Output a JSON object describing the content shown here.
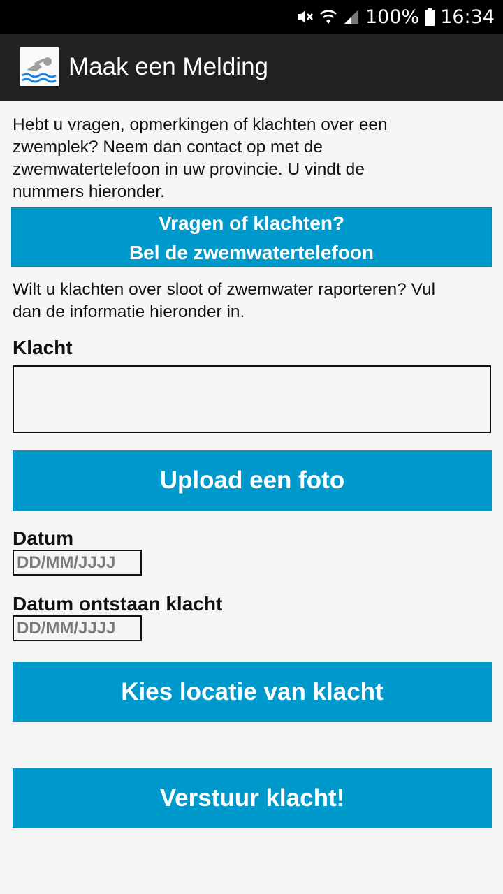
{
  "status_bar": {
    "battery": "100%",
    "time": "16:34"
  },
  "app_bar": {
    "title": "Maak een Melding",
    "icon": "swimmer-icon"
  },
  "intro_text": "Hebt u vragen, opmerkingen of klachten over een zwemplek? Neem dan contact op met de zwemwatertelefoon in uw provincie. U vindt de nummers hieronder.",
  "call_button": {
    "line1": "Vragen of klachten?",
    "line2": "Bel de zwemwatertelefoon"
  },
  "info_text": "Wilt u klachten over sloot of zwemwater raporteren? Vul dan de informatie hieronder in.",
  "form": {
    "klacht_label": "Klacht",
    "klacht_value": "",
    "upload_label": "Upload een foto",
    "datum_label": "Datum",
    "datum_placeholder": "DD/MM/JJJJ",
    "datum_ontstaan_label": "Datum ontstaan klacht",
    "datum_ontstaan_placeholder": "DD/MM/JJJJ",
    "location_label": "Kies locatie van klacht",
    "submit_label": "Verstuur klacht!"
  },
  "colors": {
    "accent": "#0099cc",
    "app_bar": "#212121",
    "background": "#f5f5f5"
  }
}
